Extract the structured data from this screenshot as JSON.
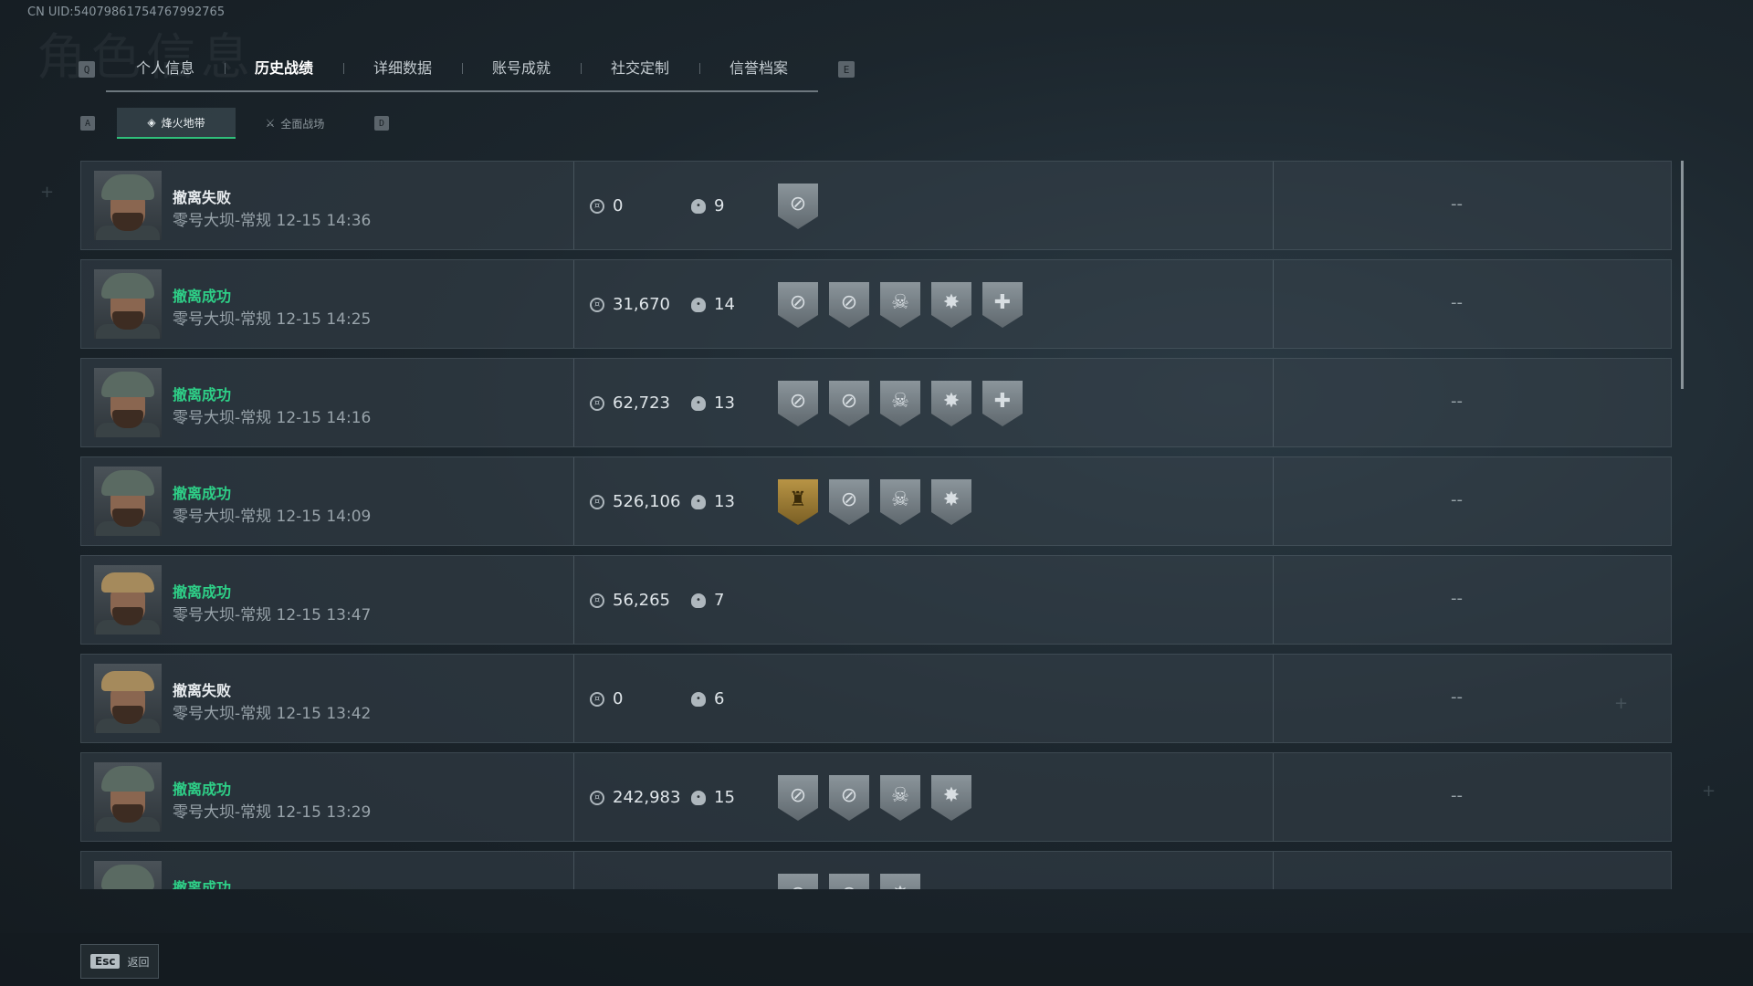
{
  "uid": "CN UID:540798617547679927​65",
  "tabs": {
    "left_key": "Q",
    "right_key": "E",
    "items": [
      {
        "label": "个人信息",
        "active": false
      },
      {
        "label": "历史战绩",
        "active": true
      },
      {
        "label": "详细数据",
        "active": false
      },
      {
        "label": "账号成就",
        "active": false
      },
      {
        "label": "社交定制",
        "active": false
      },
      {
        "label": "信誉档案",
        "active": false
      }
    ]
  },
  "subtabs": {
    "left_key": "A",
    "right_key": "D",
    "items": [
      {
        "label": "烽火地带",
        "active": true
      },
      {
        "label": "全面战场",
        "active": false
      }
    ]
  },
  "rows": [
    {
      "status": "撤离失败",
      "success": false,
      "map": "零号大坝-常规 12-15 14:36",
      "value": "0",
      "kills": "9",
      "badges": [
        "crosshair-badge"
      ],
      "extra": "--",
      "avatar": "cap"
    },
    {
      "status": "撤离成功",
      "success": true,
      "map": "零号大坝-常规 12-15 14:25",
      "value": "31,670",
      "kills": "14",
      "badges": [
        "crosshair-badge",
        "crosshair-badge",
        "skull-badge",
        "burst-badge",
        "medic-badge"
      ],
      "extra": "--",
      "avatar": "cap"
    },
    {
      "status": "撤离成功",
      "success": true,
      "map": "零号大坝-常规 12-15 14:16",
      "value": "62,723",
      "kills": "13",
      "badges": [
        "crosshair-badge",
        "crosshair-badge",
        "skull-badge",
        "burst-badge",
        "medic-badge"
      ],
      "extra": "--",
      "avatar": "cap"
    },
    {
      "status": "撤离成功",
      "success": true,
      "map": "零号大坝-常规 12-15 14:09",
      "value": "526,106",
      "kills": "13",
      "badges": [
        "gold-skull-badge",
        "crosshair-badge",
        "skull-badge",
        "burst-badge"
      ],
      "extra": "--",
      "avatar": "cap"
    },
    {
      "status": "撤离成功",
      "success": true,
      "map": "零号大坝-常规 12-15 13:47",
      "value": "56,265",
      "kills": "7",
      "badges": [],
      "extra": "--",
      "avatar": "blond"
    },
    {
      "status": "撤离失败",
      "success": false,
      "map": "零号大坝-常规 12-15 13:42",
      "value": "0",
      "kills": "6",
      "badges": [],
      "extra": "--",
      "avatar": "blond"
    },
    {
      "status": "撤离成功",
      "success": true,
      "map": "零号大坝-常规 12-15 13:29",
      "value": "242,983",
      "kills": "15",
      "badges": [
        "crosshair-badge",
        "crosshair-badge",
        "skull-badge",
        "burst-badge"
      ],
      "extra": "--",
      "avatar": "cap"
    },
    {
      "status": "撤离成功",
      "success": true,
      "map": "",
      "value": "",
      "kills": "",
      "badges": [
        "crosshair-badge",
        "crosshair-badge",
        "burst-badge"
      ],
      "extra": "",
      "avatar": "cap"
    }
  ],
  "footer": {
    "esc_key": "Esc",
    "back_label": "返回"
  },
  "colors": {
    "success": "#2ecf87",
    "accent_underline": "#2fbf7a"
  }
}
